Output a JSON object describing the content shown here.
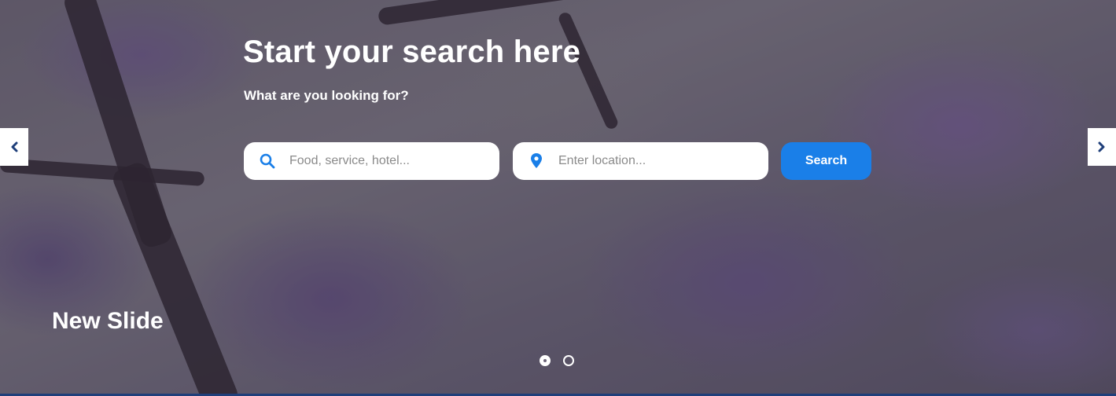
{
  "hero": {
    "title": "Start your search here",
    "subtitle": "What are you looking for?"
  },
  "search": {
    "keyword_placeholder": "Food, service, hotel...",
    "keyword_icon": "search-icon",
    "location_placeholder": "Enter location...",
    "location_icon": "map-pin-icon",
    "button_label": "Search"
  },
  "slider": {
    "caption": "New Slide",
    "prev_icon": "chevron-left-icon",
    "next_icon": "chevron-right-icon",
    "active_slide": 1,
    "total_slides": 2
  },
  "colors": {
    "accent": "#1a7fe8",
    "arrow_icon": "#1f3f7a",
    "text_on_image": "#ffffff"
  }
}
